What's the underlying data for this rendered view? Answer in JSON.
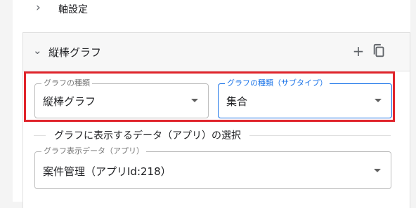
{
  "axis_settings": {
    "label": "軸設定"
  },
  "card": {
    "title": "縦棒グラフ",
    "icons": {
      "expand": "chevron-down-icon",
      "add": "plus-icon",
      "copy": "copy-icon"
    }
  },
  "fields": {
    "graph_type": {
      "label": "グラフの種類",
      "value": "縦棒グラフ"
    },
    "graph_subtype": {
      "label": "グラフの種類（サブタイプ）",
      "value": "集合"
    },
    "data_source": {
      "label": "グラフ表示データ（アプリ）",
      "value": "案件管理（アプリId:218）"
    }
  },
  "section": {
    "title": "グラフに表示するデータ（アプリ）の選択"
  },
  "next_label": "",
  "colors": {
    "highlight": "#e0242b",
    "focus": "#1a73e8"
  }
}
